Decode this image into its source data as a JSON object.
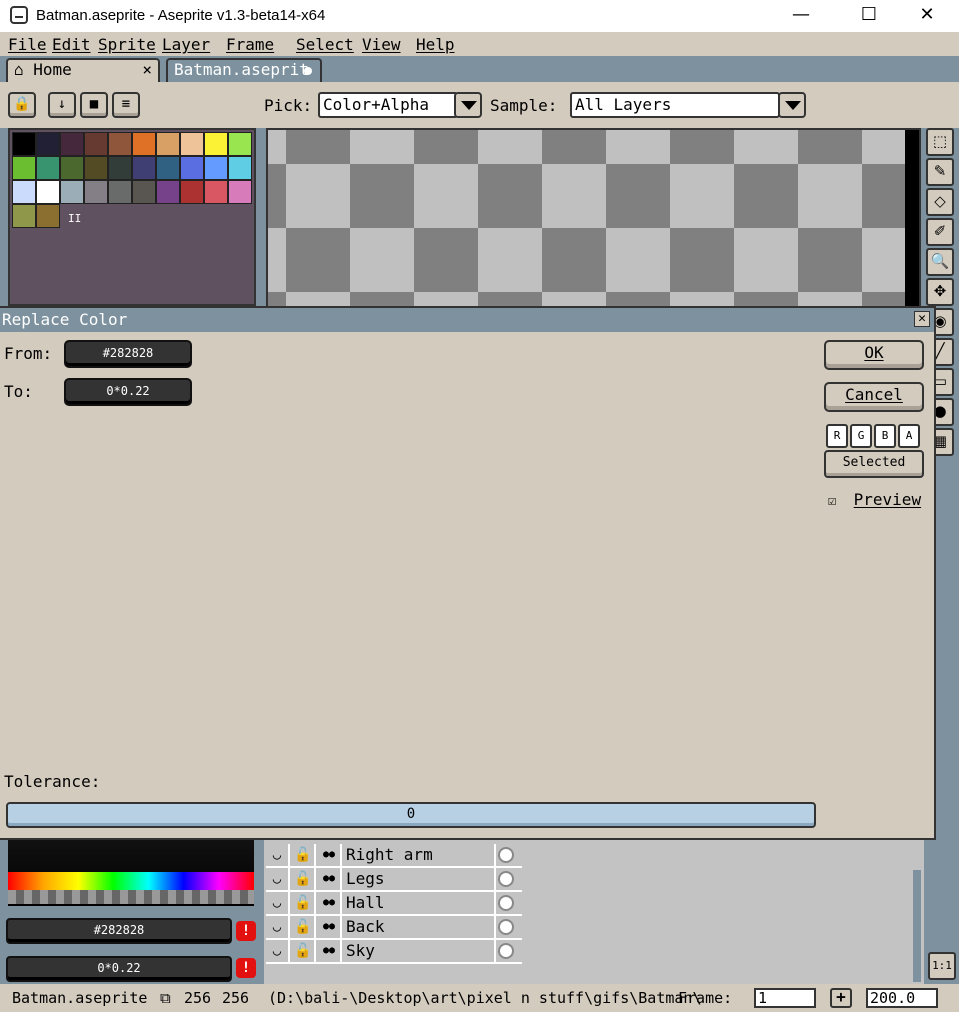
{
  "window": {
    "title": "Batman.aseprite - Aseprite v1.3-beta14-x64",
    "minimize": "—",
    "maximize": "☐",
    "close": "✕"
  },
  "menu": [
    "File",
    "Edit",
    "Sprite",
    "Layer",
    "Frame",
    "Select",
    "View",
    "Help"
  ],
  "tabs": {
    "home": "Home",
    "home_close": "×",
    "file": "Batman.aseprit"
  },
  "context_bar": {
    "pick_label": "Pick:",
    "pick_value": "Color+Alpha",
    "sample_label": "Sample:",
    "sample_value": "All Layers",
    "buttons": [
      "🔒",
      "↓",
      "■",
      "≡"
    ]
  },
  "palette": {
    "colors": [
      "#000000",
      "#222034",
      "#45283c",
      "#663931",
      "#8f563b",
      "#df7126",
      "#d9a066",
      "#eec39a",
      "#fbf236",
      "#99e550",
      "#6abe30",
      "#37946e",
      "#4b692f",
      "#524b24",
      "#323c39",
      "#3f3f74",
      "#306082",
      "#5b6ee1",
      "#639bff",
      "#5fcde4",
      "#cbdbfc",
      "#ffffff",
      "#9badb7",
      "#847e87",
      "#696a6a",
      "#595652",
      "#76428a",
      "#ac3232",
      "#d95763",
      "#d77bba",
      "#8f974a",
      "#8a6f30"
    ],
    "mark": "II"
  },
  "tools": [
    "⬚",
    "✎",
    "◇",
    "✐",
    "🔍",
    "✥",
    "◉",
    "╱",
    "▭",
    "●",
    "▦"
  ],
  "dialog": {
    "title": "Replace Color",
    "close": "✕",
    "from_label": "From:",
    "from_value": "#282828",
    "to_label": "To:",
    "to_value": "0*0.22",
    "ok": "OK",
    "cancel": "Cancel",
    "channels": [
      "R",
      "G",
      "B",
      "A"
    ],
    "selected": "Selected",
    "preview_check": "☑",
    "preview": "Preview",
    "preview_checked": true,
    "tolerance_label": "Tolerance:",
    "tolerance_value": "0"
  },
  "color_bar": {
    "fg": "#282828",
    "bg": "0*0.22",
    "warn": "!"
  },
  "layers": [
    {
      "name": "Right arm",
      "eye": "◡",
      "lock": "🔓",
      "cont": "●●"
    },
    {
      "name": "Legs",
      "eye": "◡",
      "lock": "🔓",
      "cont": "●●"
    },
    {
      "name": "Hall",
      "eye": "◡",
      "lock": "🔓",
      "cont": "●●"
    },
    {
      "name": "Back",
      "eye": "◡",
      "lock": "🔓",
      "cont": "●●"
    },
    {
      "name": "Sky",
      "eye": "◡",
      "lock": "🔓",
      "cont": "●●"
    }
  ],
  "zoom_reset": "1:1",
  "status": {
    "file": "Batman.aseprite",
    "size_w": "256",
    "size_h": "256",
    "path": "(D:\\bali-\\Desktop\\art\\pixel n stuff\\gifs\\Batman\\",
    "frame_label": "Frame:",
    "frame_value": "1",
    "plus": "+",
    "zoom": "200.0"
  }
}
